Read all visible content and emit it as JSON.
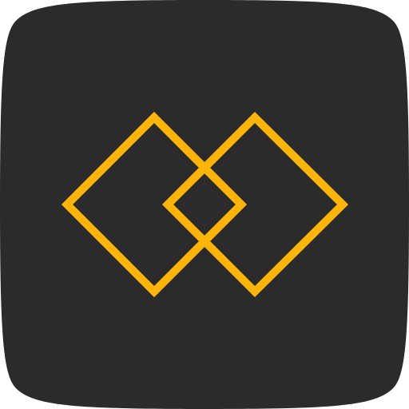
{
  "icon": {
    "name": "interlocking-diamonds-icon",
    "colors": {
      "page_background": "#ffffff",
      "tile_background": "#2b2b2b",
      "stroke": "#fdb50c"
    }
  }
}
